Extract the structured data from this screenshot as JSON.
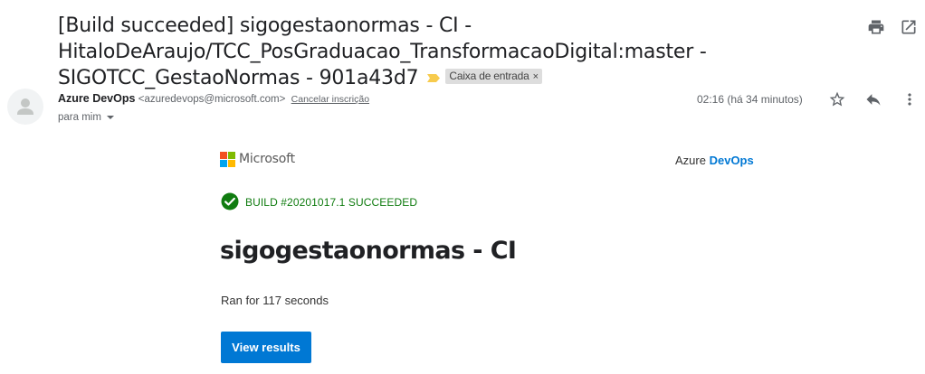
{
  "email": {
    "subject": "[Build succeeded] sigogestaonormas - CI - HitaloDeAraujo/TCC_PosGraduacao_TransformacaoDigital:master - SIGOTCC_GestaoNormas - 901a43d7",
    "label": "Caixa de entrada",
    "label_close": "×",
    "sender_name": "Azure DevOps",
    "sender_email": "<azuredevops@microsoft.com>",
    "unsubscribe": "Cancelar inscrição",
    "recipient": "para mim",
    "timestamp": "02:16 (há 34 minutos)",
    "icons": [
      "print-icon",
      "open-in-new-window-icon",
      "star-icon",
      "reply-icon",
      "more-vert-icon",
      "importance-marker-icon"
    ]
  },
  "body": {
    "brand": "Microsoft",
    "product_prefix": "Azure",
    "product_strong": "DevOps",
    "build_status": "BUILD #20201017.1 SUCCEEDED",
    "pipeline_name": "sigogestaonormas - CI",
    "duration": "Ran for 117 seconds",
    "button_label": "View results"
  },
  "colors": {
    "accent": "#0078d4",
    "success": "#107c10",
    "ms_red": "#f25022",
    "ms_green": "#7fba00",
    "ms_blue": "#00a4ef",
    "ms_yellow": "#ffb900",
    "importance_marker": "#f7cb4d"
  }
}
